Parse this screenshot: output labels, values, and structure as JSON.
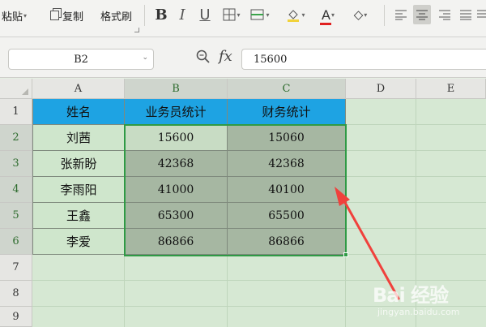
{
  "toolbar": {
    "paste_label": "粘贴",
    "copy_label": "复制",
    "format_painter_label": "格式刷",
    "bold": "B",
    "italic": "I",
    "underline": "U",
    "font_color_glyph": "A"
  },
  "formula_bar": {
    "cell_ref": "B2",
    "fx_label": "fx",
    "value": "15600"
  },
  "columns": [
    "A",
    "B",
    "C",
    "D",
    "E"
  ],
  "rows": [
    "1",
    "2",
    "3",
    "4",
    "5",
    "6",
    "7",
    "8",
    "9"
  ],
  "table": {
    "headers": [
      "姓名",
      "业务员统计",
      "财务统计"
    ],
    "data": [
      [
        "刘茜",
        "15600",
        "15060"
      ],
      [
        "张新盼",
        "42368",
        "42368"
      ],
      [
        "李雨阳",
        "41000",
        "40100"
      ],
      [
        "王鑫",
        "65300",
        "65500"
      ],
      [
        "李爱",
        "86866",
        "86866"
      ]
    ]
  },
  "colors": {
    "header_fill": "#1ea3e3",
    "selection_border": "#2f9a45",
    "arrow": "#f0413c"
  },
  "watermark": {
    "logo": "Bai 经验",
    "sub": "jingyan.baidu.com"
  }
}
